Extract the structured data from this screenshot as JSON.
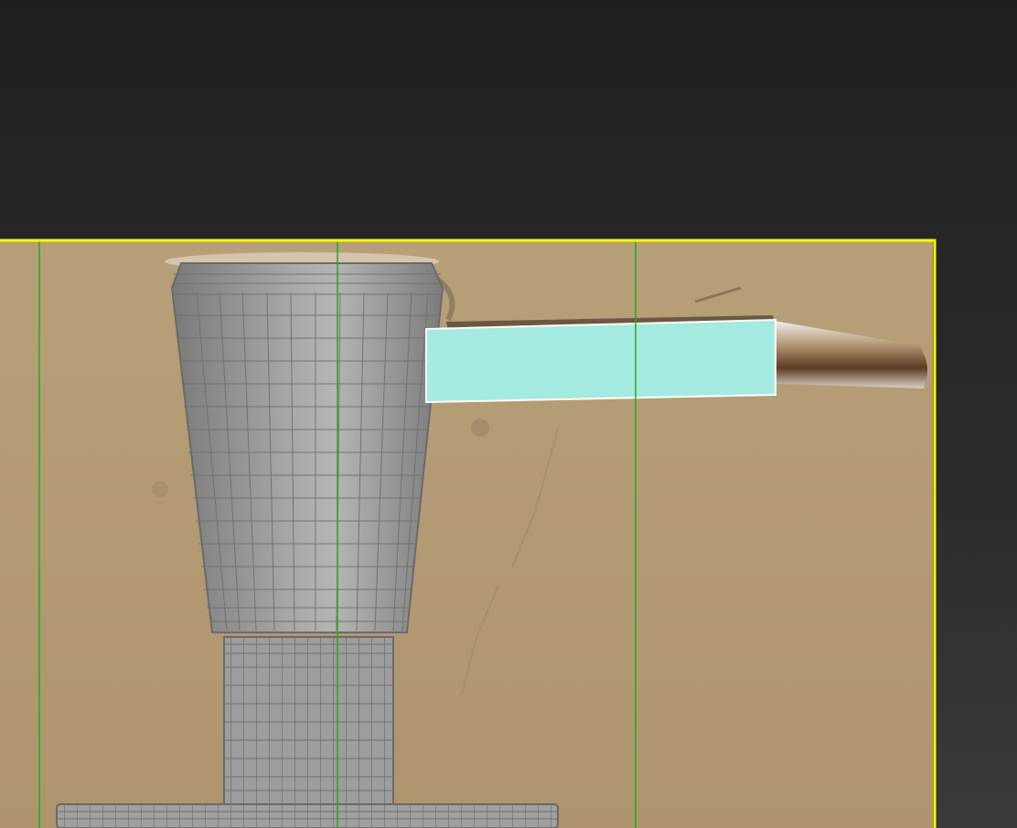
{
  "viewport": {
    "background_top": "#1f1f1f",
    "background_bottom": "#3a3a3a",
    "safe_frame_color": "#ffff00",
    "guide_line_color": "#22aa22"
  },
  "backdrop": {
    "wall_color": "#b39a72",
    "chrome_color": "#d8d8d8"
  },
  "model": {
    "mesh_color": "#8f8f8f",
    "wire_color": "#6a6a6a",
    "selection_fill": "#a4eae0",
    "selection_outline": "#ffffff"
  }
}
